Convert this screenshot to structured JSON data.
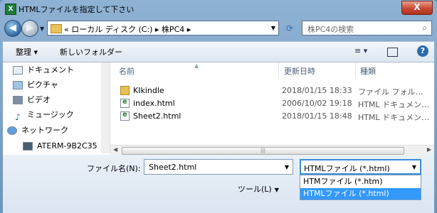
{
  "window": {
    "title": "HTMLファイルを指定して下さい",
    "app_icon": "excel-icon",
    "close_label": "X"
  },
  "nav": {
    "back_glyph": "◀",
    "forward_glyph": "▶",
    "address": "« ローカル ディスク (C:) ▸ 株PC4 ▸",
    "search_placeholder": "株PC4の検索"
  },
  "toolbar": {
    "organize": "整理 ▾",
    "new_folder": "新しいフォルダー",
    "view": "≡ ▾",
    "help": "?"
  },
  "sidebar": {
    "items": [
      {
        "label": "ドキュメント",
        "icon": "document-icon"
      },
      {
        "label": "ピクチャ",
        "icon": "picture-icon"
      },
      {
        "label": "ビデオ",
        "icon": "video-icon"
      },
      {
        "label": "ミュージック",
        "icon": "music-icon"
      },
      {
        "label": "ネットワーク",
        "icon": "network-icon"
      },
      {
        "label": "ATERM-9B2C35",
        "icon": "computer-icon"
      }
    ]
  },
  "filelist": {
    "columns": {
      "name": "名前",
      "date": "更新日時",
      "type": "種類"
    },
    "rows": [
      {
        "name": "KIkindle",
        "date": "2018/01/15 18:33",
        "type": "ファイル フォル…",
        "icon": "folder-icon"
      },
      {
        "name": "index.html",
        "date": "2006/10/02 19:18",
        "type": "HTML ドキュメン…",
        "icon": "html-icon"
      },
      {
        "name": "Sheet2.html",
        "date": "2018/01/15 18:48",
        "type": "HTML ドキュメン…",
        "icon": "html-icon"
      }
    ]
  },
  "bottom": {
    "filename_label": "ファイル名(N):",
    "filename_value": "Sheet2.html",
    "filetype_value": "HTMLファイル (*.html)",
    "tools_label": "ツール(L)",
    "filetype_options": [
      "HTMファイル (*.htm)",
      "HTMLファイル (*.html)"
    ]
  }
}
